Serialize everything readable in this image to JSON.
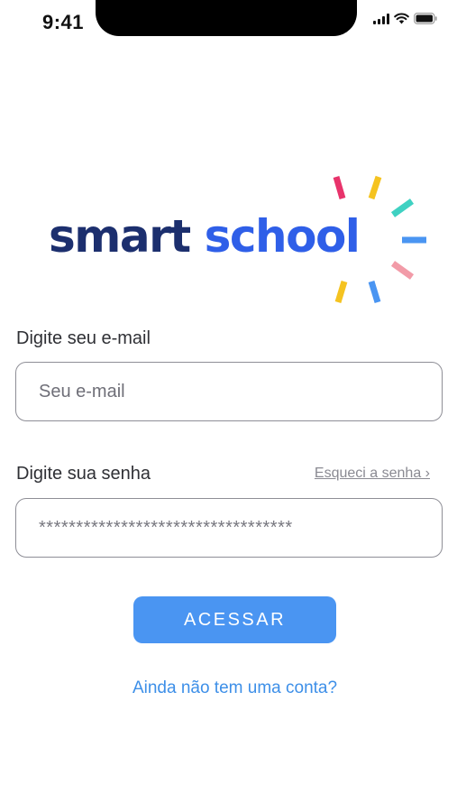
{
  "status_bar": {
    "time": "9:41"
  },
  "logo": {
    "word_1": "smart",
    "word_2": "school",
    "colors": {
      "word_1": "#1c2f6e",
      "word_2": "#2f5fe8",
      "rays": [
        "#e8336b",
        "#f5c320",
        "#3fd1c2",
        "#4a95f2",
        "#f29ba8",
        "#4a95f2",
        "#f5c320"
      ]
    }
  },
  "form": {
    "email_label": "Digite seu e-mail",
    "email_placeholder": "Seu e-mail",
    "password_label": "Digite sua senha",
    "forgot_link": "Esqueci a senha ›",
    "password_value": "**********************************",
    "submit_label": "ACESSAR",
    "signup_link": "Ainda não tem uma conta?"
  },
  "colors": {
    "primary": "#4a95f2",
    "link": "#3d8fe8"
  }
}
